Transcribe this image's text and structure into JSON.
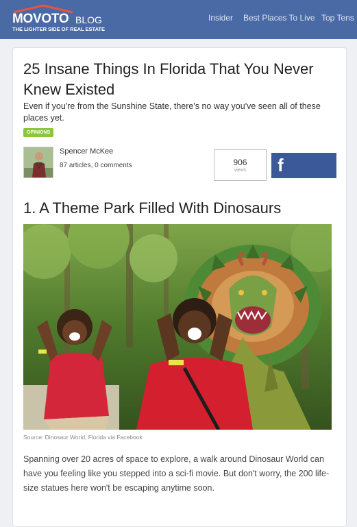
{
  "header": {
    "logo_main": "MOVOTO",
    "logo_blog": "BLOG",
    "tagline": "THE LIGHTER SIDE OF REAL ESTATE",
    "nav": [
      "Insider",
      "Best Places To Live",
      "Top Tens"
    ],
    "bar_color": "#4a6aa6"
  },
  "article": {
    "title": "25 Insane Things In Florida That You Never Knew Existed",
    "subtitle": "Even if you're from the Sunshine State, there's no way you've seen all of these places yet.",
    "category_badge": "OPINIONS",
    "author": {
      "name": "Spencer McKee",
      "meta": "87 articles, 0 comments"
    },
    "views": {
      "count": "906",
      "label": "views"
    },
    "share": {
      "icon": "facebook-icon",
      "glyph": "f",
      "color": "#3b5998"
    },
    "section": {
      "heading": "1. A Theme Park Filled With Dinosaurs",
      "image_caption": "Source: Dinosaur World, Florida via Facebook",
      "body": "Spanning over 20 acres of space to explore, a walk around Dinosaur World can have you feeling like you stepped into a sci-fi movie. But don't worry, the 200 life-size statues here won't be escaping anytime soon."
    }
  }
}
